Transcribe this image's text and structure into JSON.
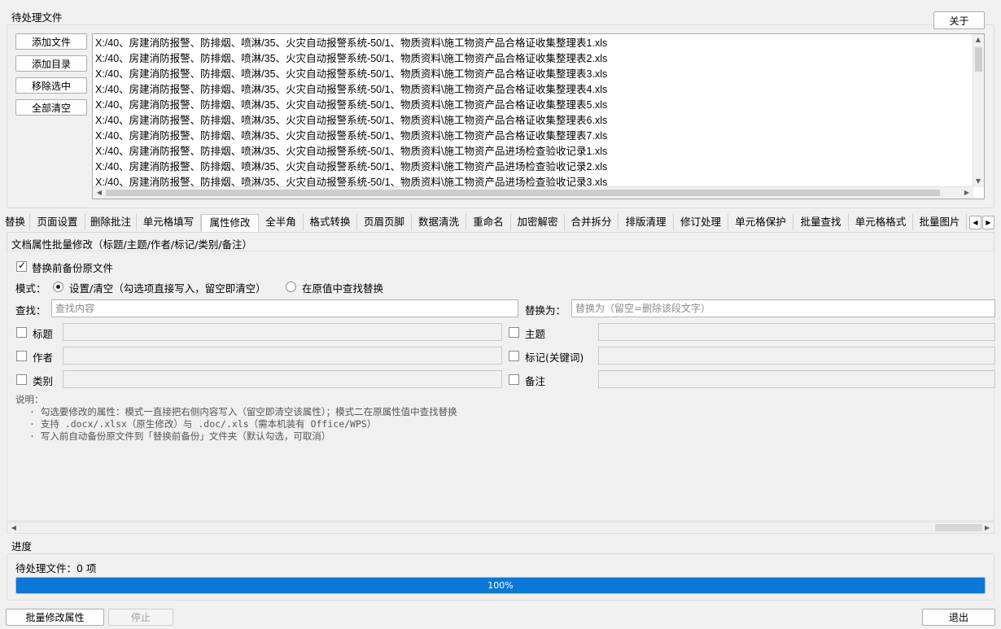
{
  "file_section": {
    "title": "待处理文件",
    "about_label": "关于",
    "buttons": {
      "add_file": "添加文件",
      "add_dir": "添加目录",
      "remove_selected": "移除选中",
      "clear_all": "全部清空"
    },
    "files": [
      "X:/40、房建消防报警、防排烟、喷淋/35、火灾自动报警系统-50/1、物质资料\\施工物资产品合格证收集整理表1.xls",
      "X:/40、房建消防报警、防排烟、喷淋/35、火灾自动报警系统-50/1、物质资料\\施工物资产品合格证收集整理表2.xls",
      "X:/40、房建消防报警、防排烟、喷淋/35、火灾自动报警系统-50/1、物质资料\\施工物资产品合格证收集整理表3.xls",
      "X:/40、房建消防报警、防排烟、喷淋/35、火灾自动报警系统-50/1、物质资料\\施工物资产品合格证收集整理表4.xls",
      "X:/40、房建消防报警、防排烟、喷淋/35、火灾自动报警系统-50/1、物质资料\\施工物资产品合格证收集整理表5.xls",
      "X:/40、房建消防报警、防排烟、喷淋/35、火灾自动报警系统-50/1、物质资料\\施工物资产品合格证收集整理表6.xls",
      "X:/40、房建消防报警、防排烟、喷淋/35、火灾自动报警系统-50/1、物质资料\\施工物资产品合格证收集整理表7.xls",
      "X:/40、房建消防报警、防排烟、喷淋/35、火灾自动报警系统-50/1、物质资料\\施工物资产品进场检查验收记录1.xls",
      "X:/40、房建消防报警、防排烟、喷淋/35、火灾自动报警系统-50/1、物质资料\\施工物资产品进场检查验收记录2.xls",
      "X:/40、房建消防报警、防排烟、喷淋/35、火灾自动报警系统-50/1、物质资料\\施工物资产品进场检查验收记录3.xls"
    ]
  },
  "tabs": [
    "替换",
    "页面设置",
    "删除批注",
    "单元格填写",
    "属性修改",
    "全半角",
    "格式转换",
    "页眉页脚",
    "数据清洗",
    "重命名",
    "加密解密",
    "合并拆分",
    "排版清理",
    "修订处理",
    "单元格保护",
    "批量查找",
    "单元格格式",
    "批量图片"
  ],
  "active_tab": "属性修改",
  "panel": {
    "heading": "文档属性批量修改（标题/主题/作者/标记/类别/备注）",
    "backup_label": "替换前备份原文件",
    "mode_label": "模式：",
    "mode_option1": "设置/清空（勾选项直接写入，留空即清空）",
    "mode_option2": "在原值中查找替换",
    "find_label": "查找：",
    "find_placeholder": "查找内容",
    "replace_label": "替换为：",
    "replace_placeholder": "替换为（留空=删除该段文字）",
    "fields": {
      "title": "标题",
      "subject": "主题",
      "author": "作者",
      "keywords": "标记(关键词)",
      "category": "类别",
      "comments": "备注"
    },
    "notes_title": "说明：",
    "notes": [
      "·  勾选要修改的属性：模式一直接把右侧内容写入（留空即清空该属性）；模式二在原属性值中查找替换",
      "·  支持 .docx/.xlsx（原生修改）与 .doc/.xls（需本机装有 Office/WPS）",
      "·  写入前自动备份原文件到「替换前备份」文件夹（默认勾选，可取消）"
    ]
  },
  "progress": {
    "title": "进度",
    "pending_text": "待处理文件：0 项",
    "percent": 100,
    "percent_label": "100%"
  },
  "footer": {
    "run_label": "批量修改属性",
    "stop_label": "停止",
    "exit_label": "退出"
  },
  "colors": {
    "progress_fill": "#0a78d7",
    "background": "#f0f0f0"
  }
}
